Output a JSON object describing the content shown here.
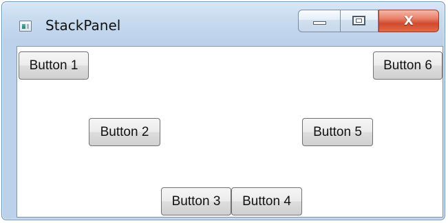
{
  "window": {
    "title": "StackPanel",
    "app_icon": "window-app-icon"
  },
  "caption_buttons": {
    "minimize_icon": "minimize-icon",
    "maximize_icon": "maximize-icon",
    "close_label": "X"
  },
  "content": {
    "buttons": [
      {
        "label": "Button 1"
      },
      {
        "label": "Button 2"
      },
      {
        "label": "Button 3"
      },
      {
        "label": "Button 4"
      },
      {
        "label": "Button 5"
      },
      {
        "label": "Button 6"
      }
    ]
  },
  "colors": {
    "window_frame": "#bcd2ea",
    "close_button": "#cf4a2f",
    "client_background": "#ffffff",
    "button_border": "#707070"
  }
}
